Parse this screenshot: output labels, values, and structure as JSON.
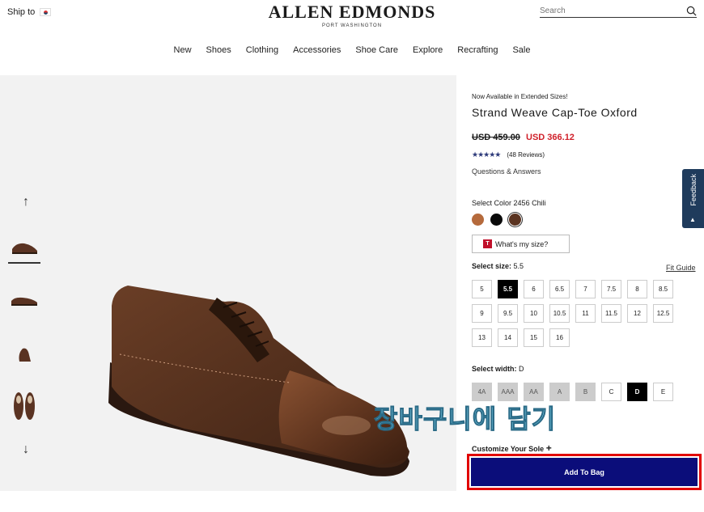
{
  "header": {
    "ship_to": "Ship to",
    "logo": "ALLEN EDMONDS",
    "logo_sub": "PORT WASHINGTON",
    "search_placeholder": "Search"
  },
  "nav": [
    "New",
    "Shoes",
    "Clothing",
    "Accessories",
    "Shoe Care",
    "Explore",
    "Recrafting",
    "Sale"
  ],
  "product": {
    "availability": "Now Available in Extended Sizes!",
    "name": "Strand Weave Cap-Toe Oxford",
    "old_price": "USD 459.00",
    "new_price": "USD 366.12",
    "stars": "★★★★★",
    "reviews": "(48 Reviews)",
    "qa": "Questions & Answers",
    "select_color": "Select Color",
    "color_name": "2456 Chili",
    "fit_button": "What's my size?",
    "select_size": "Select size:",
    "size_value": "5.5",
    "fit_guide": "Fit Guide",
    "sizes": [
      "5",
      "5.5",
      "6",
      "6.5",
      "7",
      "7.5",
      "8",
      "8.5",
      "9",
      "9.5",
      "10",
      "10.5",
      "11",
      "11.5",
      "12",
      "12.5",
      "13",
      "14",
      "15",
      "16"
    ],
    "selected_size": "5.5",
    "select_width": "Select width:",
    "width_value": "D",
    "widths": [
      "4A",
      "AAA",
      "AA",
      "A",
      "B",
      "C",
      "D",
      "E"
    ],
    "selected_width": "D",
    "unavailable_widths": [
      "4A",
      "AAA",
      "AA",
      "A",
      "B"
    ],
    "customize_sole": "Customize Your Sole",
    "add_to_bag": "Add To Bag"
  },
  "overlay_text": "장바구니에 담기",
  "feedback": "Feedback",
  "colors": {
    "swatches": [
      "#b56a3c",
      "#0a0a0a",
      "#5a3320"
    ],
    "brand_blue": "#0b0d7a",
    "sale_red": "#d0202a",
    "highlight_red": "#e10000"
  }
}
